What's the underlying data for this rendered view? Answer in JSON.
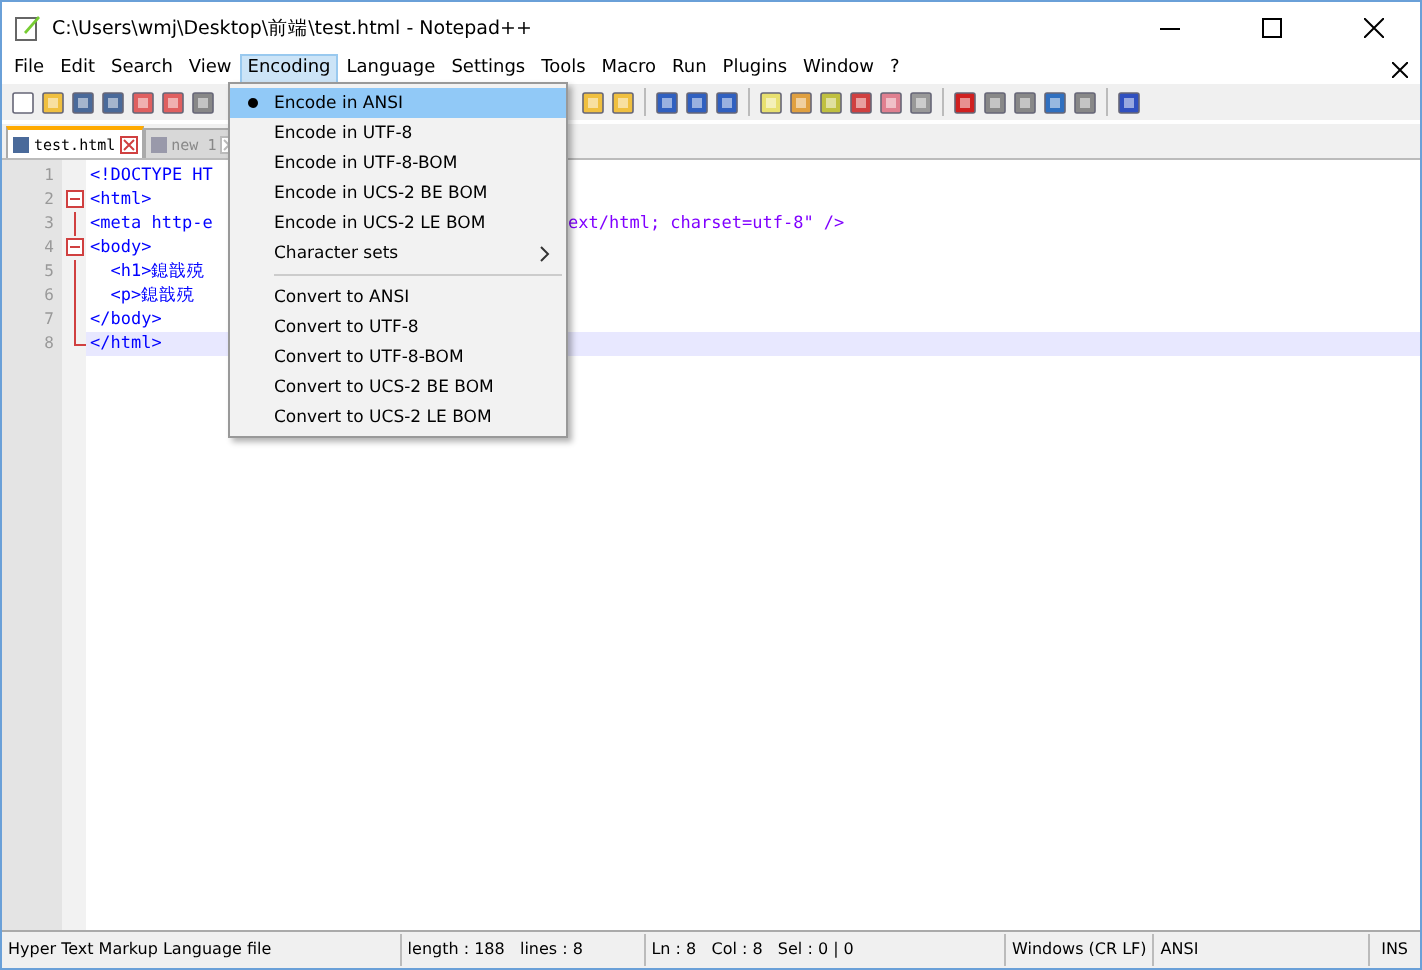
{
  "window": {
    "title": "C:\\Users\\wmj\\Desktop\\前端\\test.html - Notepad++"
  },
  "menu_bar": [
    {
      "label": "File",
      "selected": false
    },
    {
      "label": "Edit",
      "selected": false
    },
    {
      "label": "Search",
      "selected": false
    },
    {
      "label": "View",
      "selected": false
    },
    {
      "label": "Encoding",
      "selected": true
    },
    {
      "label": "Language",
      "selected": false
    },
    {
      "label": "Settings",
      "selected": false
    },
    {
      "label": "Tools",
      "selected": false
    },
    {
      "label": "Macro",
      "selected": false
    },
    {
      "label": "Run",
      "selected": false
    },
    {
      "label": "Plugins",
      "selected": false
    },
    {
      "label": "Window",
      "selected": false
    },
    {
      "label": "?",
      "selected": false
    }
  ],
  "tabs": [
    {
      "label": "test.html",
      "selected": true
    },
    {
      "label": "new 1",
      "selected": false
    }
  ],
  "editor": {
    "lines": [
      {
        "number": "1",
        "text": "<!DOCTYPE HT",
        "kind": "plain",
        "current": false
      },
      {
        "number": "2",
        "text": "<html>",
        "kind": "header",
        "current": false
      },
      {
        "number": "3",
        "text": "<meta http-e",
        "after_menu": "ext/html; charset=utf-8\" />",
        "kind": "body",
        "current": false
      },
      {
        "number": "4",
        "text": "<body>",
        "kind": "header",
        "current": false
      },
      {
        "number": "5",
        "text": "  <h1>鎴戠殑",
        "kind": "body",
        "current": false
      },
      {
        "number": "6",
        "text": "  <p>鎴戠殑",
        "kind": "body",
        "current": false
      },
      {
        "number": "7",
        "text": "</body>",
        "kind": "body",
        "current": false
      },
      {
        "number": "8",
        "text": "</html>",
        "kind": "end",
        "current": true
      }
    ]
  },
  "encoding_menu": {
    "items": [
      {
        "label": "Encode in ANSI",
        "kind": "radio",
        "checked": true,
        "highlighted": true
      },
      {
        "label": "Encode in UTF-8",
        "kind": "radio",
        "checked": false,
        "highlighted": false
      },
      {
        "label": "Encode in UTF-8-BOM",
        "kind": "radio",
        "checked": false,
        "highlighted": false
      },
      {
        "label": "Encode in UCS-2 BE BOM",
        "kind": "radio",
        "checked": false,
        "highlighted": false
      },
      {
        "label": "Encode in UCS-2 LE BOM",
        "kind": "radio",
        "checked": false,
        "highlighted": false
      },
      {
        "label": "Character sets",
        "kind": "submenu",
        "checked": false,
        "highlighted": false
      },
      {
        "kind": "separator"
      },
      {
        "label": "Convert to ANSI",
        "kind": "action",
        "checked": false,
        "highlighted": false
      },
      {
        "label": "Convert to UTF-8",
        "kind": "action",
        "checked": false,
        "highlighted": false
      },
      {
        "label": "Convert to UTF-8-BOM",
        "kind": "action",
        "checked": false,
        "highlighted": false
      },
      {
        "label": "Convert to UCS-2 BE BOM",
        "kind": "action",
        "checked": false,
        "highlighted": false
      },
      {
        "label": "Convert to UCS-2 LE BOM",
        "kind": "action",
        "checked": false,
        "highlighted": false
      }
    ]
  },
  "status_bar": [
    "Hyper Text Markup Language file",
    "length : 188   lines : 8",
    "Ln : 8   Col : 8   Sel : 0 | 0",
    "Windows (CR LF)",
    "ANSI",
    "INS"
  ]
}
